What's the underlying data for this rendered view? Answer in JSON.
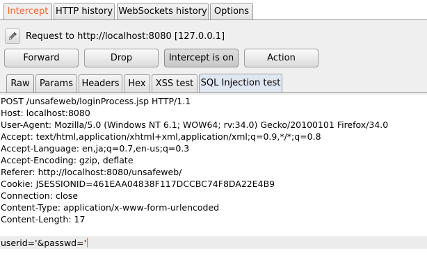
{
  "top_tabs": [
    {
      "label": "Intercept",
      "active": true
    },
    {
      "label": "HTTP history",
      "active": false
    },
    {
      "label": "WebSockets history",
      "active": false
    },
    {
      "label": "Options",
      "active": false
    }
  ],
  "request_info": "Request to http://localhost:8080  [127.0.0.1]",
  "buttons": {
    "forward": "Forward",
    "drop": "Drop",
    "intercept": "Intercept is on",
    "action": "Action"
  },
  "view_tabs": [
    {
      "label": "Raw",
      "active": false
    },
    {
      "label": "Params",
      "active": false
    },
    {
      "label": "Headers",
      "active": false
    },
    {
      "label": "Hex",
      "active": false
    },
    {
      "label": "XSS test",
      "active": false
    },
    {
      "label": "SQL Injection test",
      "active": true
    }
  ],
  "request_lines": [
    "POST /unsafeweb/loginProcess.jsp HTTP/1.1",
    "Host: localhost:8080",
    "User-Agent: Mozilla/5.0 (Windows NT 6.1; WOW64; rv:34.0) Gecko/20100101 Firefox/34.0",
    "Accept: text/html,application/xhtml+xml,application/xml;q=0.9,*/*;q=0.8",
    "Accept-Language: en,ja;q=0.7,en-us;q=0.3",
    "Accept-Encoding: gzip, deflate",
    "Referer: http://localhost:8080/unsafeweb/",
    "Cookie: JSESSIONID=461EAA04838F117DCCBC74F8DA22E4B9",
    "Connection: close",
    "Content-Type: application/x-www-form-urlencoded",
    "Content-Length: 17"
  ],
  "request_body": "userid='&passwd='",
  "colors": {
    "active_tab_text": "#ff6633",
    "caret": "#ff6600"
  }
}
